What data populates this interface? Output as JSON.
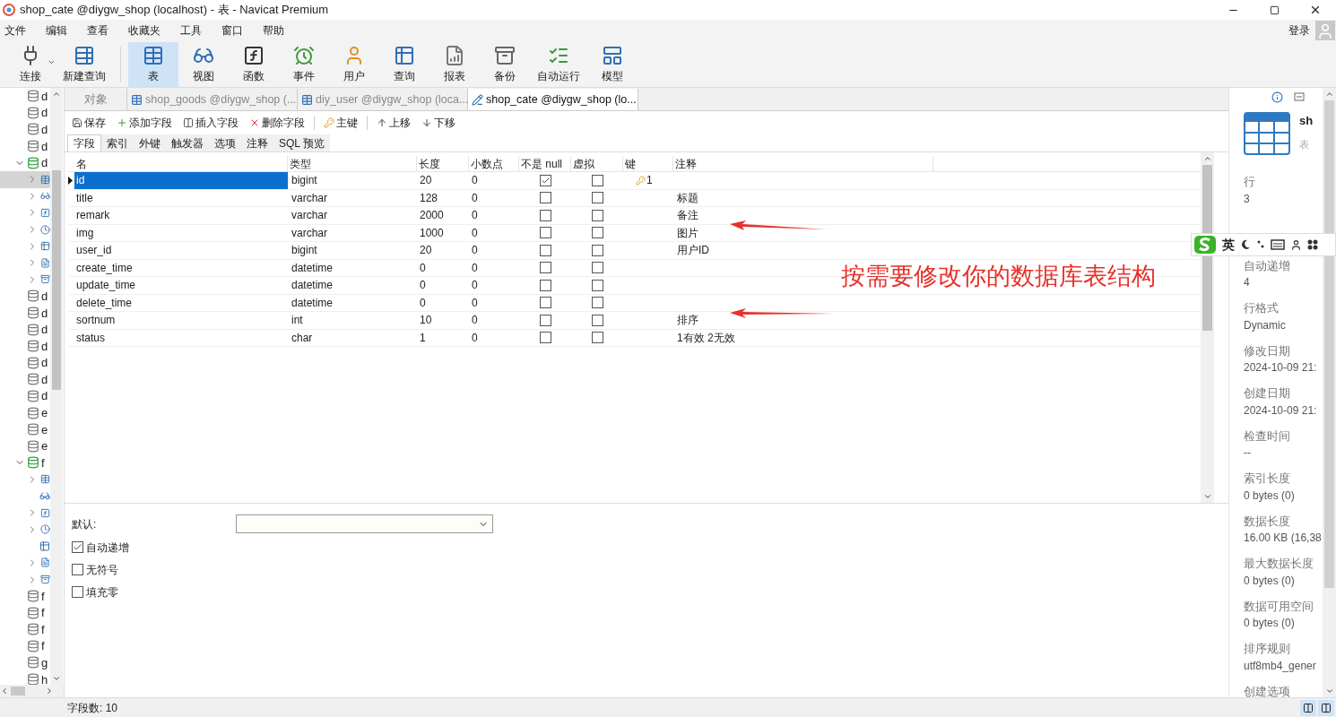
{
  "window": {
    "title": "shop_cate @diygw_shop (localhost) - 表 - Navicat Premium"
  },
  "menu": [
    "文件",
    "编辑",
    "查看",
    "收藏夹",
    "工具",
    "窗口",
    "帮助"
  ],
  "login": "登录",
  "toolbar": [
    {
      "label": "连接",
      "kind": "connect",
      "selected": false,
      "dropdown": true
    },
    {
      "label": "新建查询",
      "kind": "new_query",
      "selected": false,
      "dropdown": false
    },
    {
      "label": "表",
      "kind": "table",
      "selected": true,
      "dropdown": false
    },
    {
      "label": "视图",
      "kind": "view",
      "selected": false,
      "dropdown": false
    },
    {
      "label": "函数",
      "kind": "function",
      "selected": false,
      "dropdown": false
    },
    {
      "label": "事件",
      "kind": "event",
      "selected": false,
      "dropdown": false
    },
    {
      "label": "用户",
      "kind": "user",
      "selected": false,
      "dropdown": false
    },
    {
      "label": "查询",
      "kind": "query",
      "selected": false,
      "dropdown": false
    },
    {
      "label": "报表",
      "kind": "report",
      "selected": false,
      "dropdown": false
    },
    {
      "label": "备份",
      "kind": "backup",
      "selected": false,
      "dropdown": false
    },
    {
      "label": "自动运行",
      "kind": "automation",
      "selected": false,
      "dropdown": false
    },
    {
      "label": "模型",
      "kind": "model",
      "selected": false,
      "dropdown": false
    }
  ],
  "tree": [
    {
      "label": "d",
      "expanded": false
    },
    {
      "label": "d",
      "expanded": false
    },
    {
      "label": "d",
      "expanded": false
    },
    {
      "label": "d",
      "expanded": false
    },
    {
      "label": "d",
      "expanded": true,
      "children": [
        {
          "kind": "tables",
          "selected": true,
          "expandable": true
        },
        {
          "kind": "views",
          "selected": false,
          "expandable": true
        },
        {
          "kind": "functions",
          "selected": false,
          "expandable": true
        },
        {
          "kind": "events",
          "selected": false,
          "expandable": true
        },
        {
          "kind": "queries",
          "selected": false,
          "expandable": true
        },
        {
          "kind": "reports",
          "selected": false,
          "expandable": true
        },
        {
          "kind": "backups",
          "selected": false,
          "expandable": true
        }
      ]
    },
    {
      "label": "d",
      "expanded": false
    },
    {
      "label": "d",
      "expanded": false
    },
    {
      "label": "d",
      "expanded": false
    },
    {
      "label": "d",
      "expanded": false
    },
    {
      "label": "d",
      "expanded": false
    },
    {
      "label": "d",
      "expanded": false
    },
    {
      "label": "d",
      "expanded": false
    },
    {
      "label": "e",
      "expanded": false
    },
    {
      "label": "e",
      "expanded": false
    },
    {
      "label": "e",
      "expanded": false
    },
    {
      "label": "f",
      "expanded": true,
      "children": [
        {
          "kind": "tables",
          "selected": false,
          "expandable": true
        },
        {
          "kind": "views",
          "selected": false,
          "expandable": false
        },
        {
          "kind": "functions",
          "selected": false,
          "expandable": true
        },
        {
          "kind": "events",
          "selected": false,
          "expandable": true
        },
        {
          "kind": "queries",
          "selected": false,
          "expandable": false
        },
        {
          "kind": "reports",
          "selected": false,
          "expandable": true
        },
        {
          "kind": "backups",
          "selected": false,
          "expandable": true
        }
      ]
    },
    {
      "label": "f",
      "expanded": false
    },
    {
      "label": "f",
      "expanded": false
    },
    {
      "label": "f",
      "expanded": false
    },
    {
      "label": "f",
      "expanded": false
    },
    {
      "label": "g",
      "expanded": false
    },
    {
      "label": "h",
      "expanded": false
    }
  ],
  "tabs": [
    {
      "label": "对象",
      "kind": "objects",
      "selected": false
    },
    {
      "label": "shop_goods @diygw_shop (...",
      "kind": "table",
      "selected": false
    },
    {
      "label": "diy_user @diygw_shop (loca...",
      "kind": "table",
      "selected": false
    },
    {
      "label": "shop_cate @diygw_shop (lo...",
      "kind": "design",
      "selected": true
    }
  ],
  "actions": [
    {
      "label": "保存",
      "kind": "save"
    },
    {
      "label": "添加字段",
      "kind": "add"
    },
    {
      "label": "插入字段",
      "kind": "insert"
    },
    {
      "label": "删除字段",
      "kind": "delete"
    },
    {
      "label": "主键",
      "kind": "key"
    },
    {
      "label": "上移",
      "kind": "up"
    },
    {
      "label": "下移",
      "kind": "down"
    }
  ],
  "subtabs": [
    {
      "label": "字段",
      "selected": true
    },
    {
      "label": "索引",
      "selected": false
    },
    {
      "label": "外键",
      "selected": false
    },
    {
      "label": "触发器",
      "selected": false
    },
    {
      "label": "选项",
      "selected": false
    },
    {
      "label": "注释",
      "selected": false
    },
    {
      "label": "SQL 预览",
      "selected": false
    }
  ],
  "columns": [
    "名",
    "类型",
    "长度",
    "小数点",
    "不是 null",
    "虚拟",
    "键",
    "注释"
  ],
  "fields": [
    {
      "name": "id",
      "type": "bigint",
      "length": "20",
      "decimals": "0",
      "not_null": true,
      "virtual": false,
      "key": "1",
      "selected": true
    },
    {
      "name": "title",
      "type": "varchar",
      "length": "128",
      "decimals": "0",
      "not_null": false,
      "virtual": false,
      "comment": "标题",
      "selected": false
    },
    {
      "name": "remark",
      "type": "varchar",
      "length": "2000",
      "decimals": "0",
      "not_null": false,
      "virtual": false,
      "comment": "备注",
      "selected": false
    },
    {
      "name": "img",
      "type": "varchar",
      "length": "1000",
      "decimals": "0",
      "not_null": false,
      "virtual": false,
      "comment": "图片",
      "selected": false
    },
    {
      "name": "user_id",
      "type": "bigint",
      "length": "20",
      "decimals": "0",
      "not_null": false,
      "virtual": false,
      "comment": "用户ID",
      "selected": false
    },
    {
      "name": "create_time",
      "type": "datetime",
      "length": "0",
      "decimals": "0",
      "not_null": false,
      "virtual": false,
      "selected": false
    },
    {
      "name": "update_time",
      "type": "datetime",
      "length": "0",
      "decimals": "0",
      "not_null": false,
      "virtual": false,
      "selected": false
    },
    {
      "name": "delete_time",
      "type": "datetime",
      "length": "0",
      "decimals": "0",
      "not_null": false,
      "virtual": false,
      "selected": false
    },
    {
      "name": "sortnum",
      "type": "int",
      "length": "10",
      "decimals": "0",
      "not_null": false,
      "virtual": false,
      "comment": "排序",
      "selected": false
    },
    {
      "name": "status",
      "type": "char",
      "length": "1",
      "decimals": "0",
      "not_null": false,
      "virtual": false,
      "comment": "1有效 2无效",
      "selected": false
    }
  ],
  "annotation": {
    "text": "按需要修改你的数据库表结构"
  },
  "field_options": {
    "default_label": "默认:",
    "checkboxes": [
      {
        "label": "自动递增",
        "checked": true
      },
      {
        "label": "无符号",
        "checked": false
      },
      {
        "label": "填充零",
        "checked": false
      }
    ]
  },
  "status_bar": {
    "text": "字段数: 10"
  },
  "info_panel": {
    "name": "sh",
    "type": "表",
    "ime_label": "英",
    "properties": [
      {
        "label": "行",
        "value": "3"
      },
      {
        "label": "自动递增",
        "value": "4"
      },
      {
        "label": "行格式",
        "value": "Dynamic"
      },
      {
        "label": "修改日期",
        "value": "2024-10-09 21:"
      },
      {
        "label": "创建日期",
        "value": "2024-10-09 21:"
      },
      {
        "label": "检查时间",
        "value": "--"
      },
      {
        "label": "索引长度",
        "value": "0 bytes (0)"
      },
      {
        "label": "数据长度",
        "value": "16.00 KB (16,38"
      },
      {
        "label": "最大数据长度",
        "value": "0 bytes (0)"
      },
      {
        "label": "数据可用空间",
        "value": "0 bytes (0)"
      },
      {
        "label": "排序规则",
        "value": "utf8mb4_gener"
      },
      {
        "label": "创建选项"
      }
    ]
  }
}
